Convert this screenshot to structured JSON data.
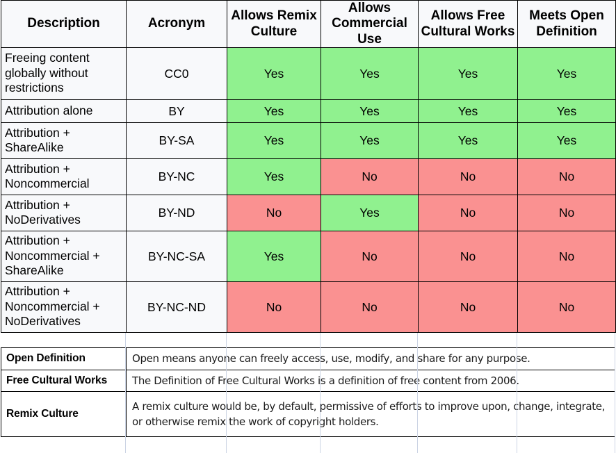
{
  "table": {
    "columns": [
      {
        "key": "description",
        "label": "Description"
      },
      {
        "key": "acronym",
        "label": "Acronym"
      },
      {
        "key": "remix",
        "label": "Allows Remix Culture"
      },
      {
        "key": "commercial",
        "label": "Allows Commercial Use"
      },
      {
        "key": "free_cultural",
        "label": "Allows Free Cultural Works"
      },
      {
        "key": "open_definition",
        "label": "Meets Open Definition"
      }
    ],
    "rows": [
      {
        "description": "Freeing content globally without restrictions",
        "acronym": "CC0",
        "remix": "Yes",
        "commercial": "Yes",
        "free_cultural": "Yes",
        "open_definition": "Yes"
      },
      {
        "description": "Attribution alone",
        "acronym": "BY",
        "remix": "Yes",
        "commercial": "Yes",
        "free_cultural": "Yes",
        "open_definition": "Yes"
      },
      {
        "description": "Attribution + ShareAlike",
        "acronym": "BY-SA",
        "remix": "Yes",
        "commercial": "Yes",
        "free_cultural": "Yes",
        "open_definition": "Yes"
      },
      {
        "description": "Attribution + Noncommercial",
        "acronym": "BY-NC",
        "remix": "Yes",
        "commercial": "No",
        "free_cultural": "No",
        "open_definition": "No"
      },
      {
        "description": "Attribution + NoDerivatives",
        "acronym": "BY-ND",
        "remix": "No",
        "commercial": "Yes",
        "free_cultural": "No",
        "open_definition": "No"
      },
      {
        "description": "Attribution + Noncommercial + ShareAlike",
        "acronym": "BY-NC-SA",
        "remix": "Yes",
        "commercial": "No",
        "free_cultural": "No",
        "open_definition": "No"
      },
      {
        "description": "Attribution + Noncommercial + NoDerivatives",
        "acronym": "BY-NC-ND",
        "remix": "No",
        "commercial": "No",
        "free_cultural": "No",
        "open_definition": "No"
      }
    ]
  },
  "definitions": [
    {
      "term": "Open Definition",
      "text": "Open means anyone can freely access, use, modify, and share for any purpose."
    },
    {
      "term": "Free Cultural Works",
      "text": "The Definition of Free Cultural Works is a definition of free content from 2006."
    },
    {
      "term": "Remix Culture",
      "text": "A remix culture would be, by default, permissive of efforts to improve upon, change, integrate, or otherwise remix the work of copyright holders."
    }
  ],
  "colors": {
    "yes": "#90F18F",
    "no": "#FA9191",
    "border": "#000000",
    "gridline": "#CCD4E4",
    "cell_background": "#F8F9FB"
  }
}
